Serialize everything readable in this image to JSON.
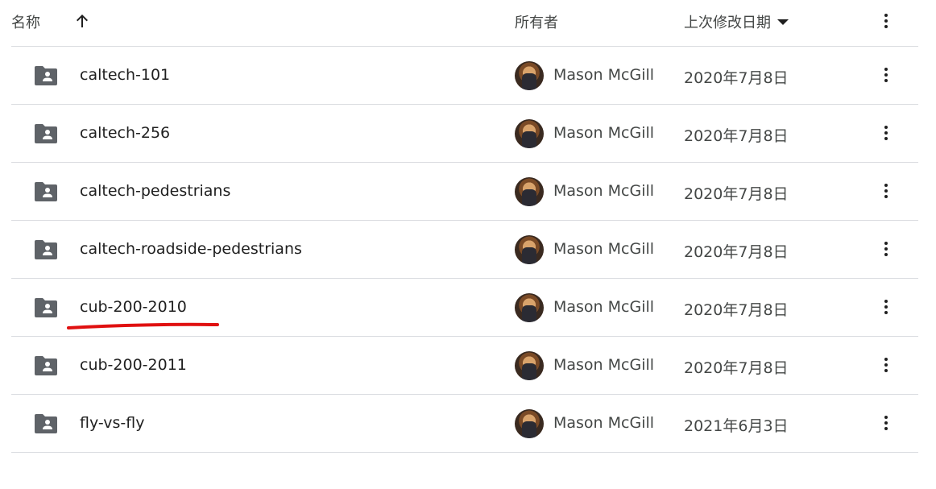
{
  "header": {
    "name_label": "名称",
    "sort_icon": "arrow-up-icon",
    "owner_label": "所有者",
    "date_label": "上次修改日期",
    "date_sort_icon": "caret-down-icon",
    "more_icon": "more-vert-icon"
  },
  "rows": [
    {
      "name": "caltech-101",
      "owner": "Mason McGill",
      "date": "2020年7月8日"
    },
    {
      "name": "caltech-256",
      "owner": "Mason McGill",
      "date": "2020年7月8日"
    },
    {
      "name": "caltech-pedestrians",
      "owner": "Mason McGill",
      "date": "2020年7月8日"
    },
    {
      "name": "caltech-roadside-pedestrians",
      "owner": "Mason McGill",
      "date": "2020年7月8日"
    },
    {
      "name": "cub-200-2010",
      "owner": "Mason McGill",
      "date": "2020年7月8日"
    },
    {
      "name": "cub-200-2011",
      "owner": "Mason McGill",
      "date": "2020年7月8日"
    },
    {
      "name": "fly-vs-fly",
      "owner": "Mason McGill",
      "date": "2021年6月3日"
    }
  ],
  "icons": {
    "folder": "shared-folder-icon",
    "row_more": "more-vert-icon"
  },
  "colors": {
    "divider": "#dadce0",
    "folder": "#5f6368",
    "annotation": "#e01010"
  }
}
